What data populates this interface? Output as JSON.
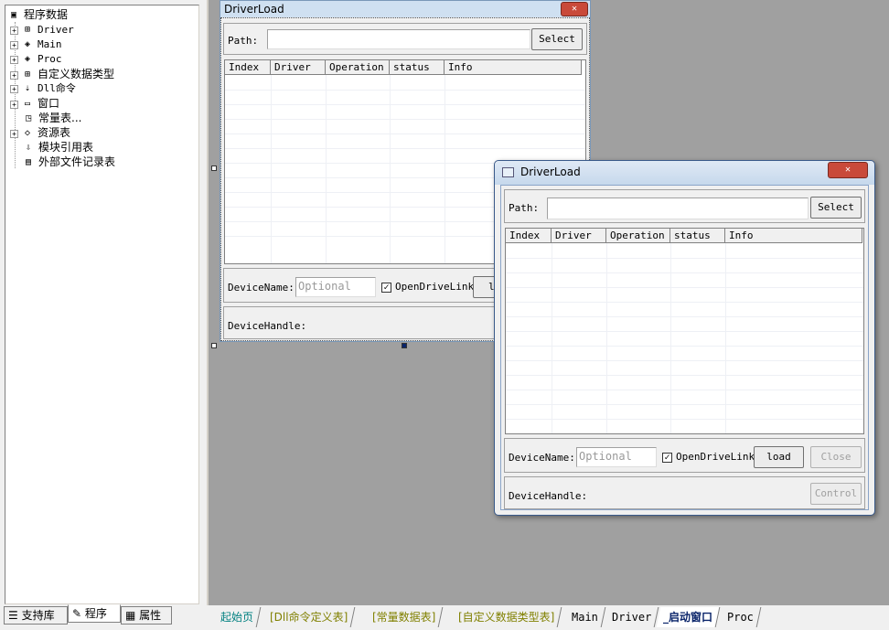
{
  "tree": {
    "root": "程序数据",
    "items": [
      {
        "label": "Driver",
        "icon": "class-icon"
      },
      {
        "label": "Main",
        "icon": "module-icon"
      },
      {
        "label": "Proc",
        "icon": "module-icon"
      },
      {
        "label": "自定义数据类型",
        "icon": "datatype-icon"
      },
      {
        "label": "Dll命令",
        "icon": "dll-icon"
      },
      {
        "label": "窗口",
        "icon": "window-icon"
      },
      {
        "label": "常量表...",
        "icon": "constant-icon"
      },
      {
        "label": "资源表",
        "icon": "resource-icon"
      },
      {
        "label": "模块引用表",
        "icon": "module-ref-icon"
      },
      {
        "label": "外部文件记录表",
        "icon": "file-record-icon"
      }
    ]
  },
  "left_tabs": [
    "支持库",
    "程序",
    "属性"
  ],
  "design_form": {
    "title": "DriverLoad",
    "path_label": "Path:",
    "select_label": "Select",
    "columns": [
      "Index",
      "Driver",
      "Operation",
      "status",
      "Info"
    ],
    "device_name_label": "DeviceName:",
    "device_name_placeholder": "Optional",
    "checkbox_label": "OpenDriveLink",
    "load_partial": "l",
    "device_handle_label": "DeviceHandle:"
  },
  "runtime_window": {
    "title": "DriverLoad",
    "path_label": "Path:",
    "select_label": "Select",
    "columns": [
      "Index",
      "Driver",
      "Operation",
      "status",
      "Info"
    ],
    "device_name_label": "DeviceName:",
    "device_name_placeholder": "Optional",
    "checkbox_label": "OpenDriveLink",
    "load_label": "load",
    "close_label": "Close",
    "device_handle_label": "DeviceHandle:",
    "control_label": "Control"
  },
  "bottom_tabs": [
    "起始页",
    "[Dll命令定义表]",
    "[常量数据表]",
    "[自定义数据类型表]",
    "Main",
    "Driver",
    "_启动窗口",
    "Proc"
  ],
  "colors": {
    "accent": "#0a246a",
    "yellow_tab": "#808000",
    "teal_tab": "#008080"
  }
}
